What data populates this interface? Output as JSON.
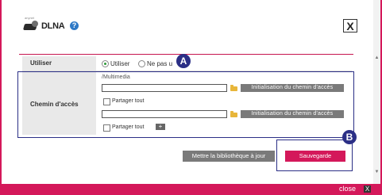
{
  "header": {
    "logo_text": "anynet",
    "title": "DLNA",
    "help_glyph": "?",
    "close_glyph": "X"
  },
  "rows": {
    "use": {
      "label": "Utiliser",
      "option_on": "Utiliser",
      "option_off": "Ne pas u",
      "selected": "on"
    },
    "path": {
      "label": "Chemin d'accès",
      "path_value": "/Multimedia",
      "entries": [
        {
          "input_value": "",
          "init_button": "Initialisation du chemin d'accès",
          "share_label": "Partager tout",
          "share_checked": false
        },
        {
          "input_value": "",
          "init_button": "Initialisation du chemin d'accès",
          "share_label": "Partager tout",
          "share_checked": false
        }
      ],
      "add_button": "+"
    }
  },
  "buttons": {
    "update_library": "Mettre la bibliothèque à jour",
    "save": "Sauvegarde"
  },
  "annotations": {
    "a": "A",
    "b": "B"
  },
  "footer": {
    "close_label": "close",
    "close_glyph": "X"
  },
  "scrollbar": {
    "up": "▲",
    "down": "▼"
  },
  "colors": {
    "accent": "#d4185a",
    "annotation": "#2b2f86",
    "button_gray": "#7a7a7a"
  }
}
